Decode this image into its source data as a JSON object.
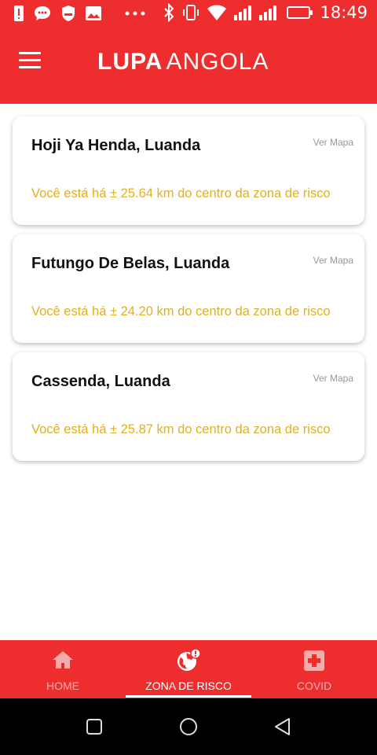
{
  "status_bar": {
    "time": "18:49",
    "icons": [
      "alert-icon",
      "chat-bubble-icon",
      "shield-icon",
      "image-icon",
      "more-dots-icon",
      "bluetooth-icon",
      "vibrate-icon",
      "wifi-icon",
      "signal-icon",
      "signal-icon",
      "battery-icon"
    ]
  },
  "app_bar": {
    "brand_bold": "LUPA",
    "brand_light": "ANGOLA",
    "menu_icon": "hamburger-menu-icon"
  },
  "zones": [
    {
      "title": "Hoji Ya Henda, Luanda",
      "link": "Ver Mapa",
      "distance": "Você está há ± 25.64 km do centro da zona de risco"
    },
    {
      "title": "Futungo De Belas, Luanda",
      "link": "Ver Mapa",
      "distance": "Você está há ± 24.20 km do centro da zona de risco"
    },
    {
      "title": "Cassenda, Luanda",
      "link": "Ver Mapa",
      "distance": "Você está há ± 25.87 km do centro da zona de risco"
    }
  ],
  "bottom_nav": {
    "items": [
      {
        "label": "HOME",
        "icon": "home-icon",
        "active": false
      },
      {
        "label": "ZONA DE RISCO",
        "icon": "globe-alert-icon",
        "active": true
      },
      {
        "label": "COVID",
        "icon": "medical-cross-icon",
        "active": false
      }
    ]
  },
  "system_nav": [
    "recents-square-icon",
    "home-circle-icon",
    "back-triangle-icon"
  ],
  "colors": {
    "primary": "#ee2e2e",
    "distance_text": "#e0b020",
    "link_text": "#999999"
  }
}
